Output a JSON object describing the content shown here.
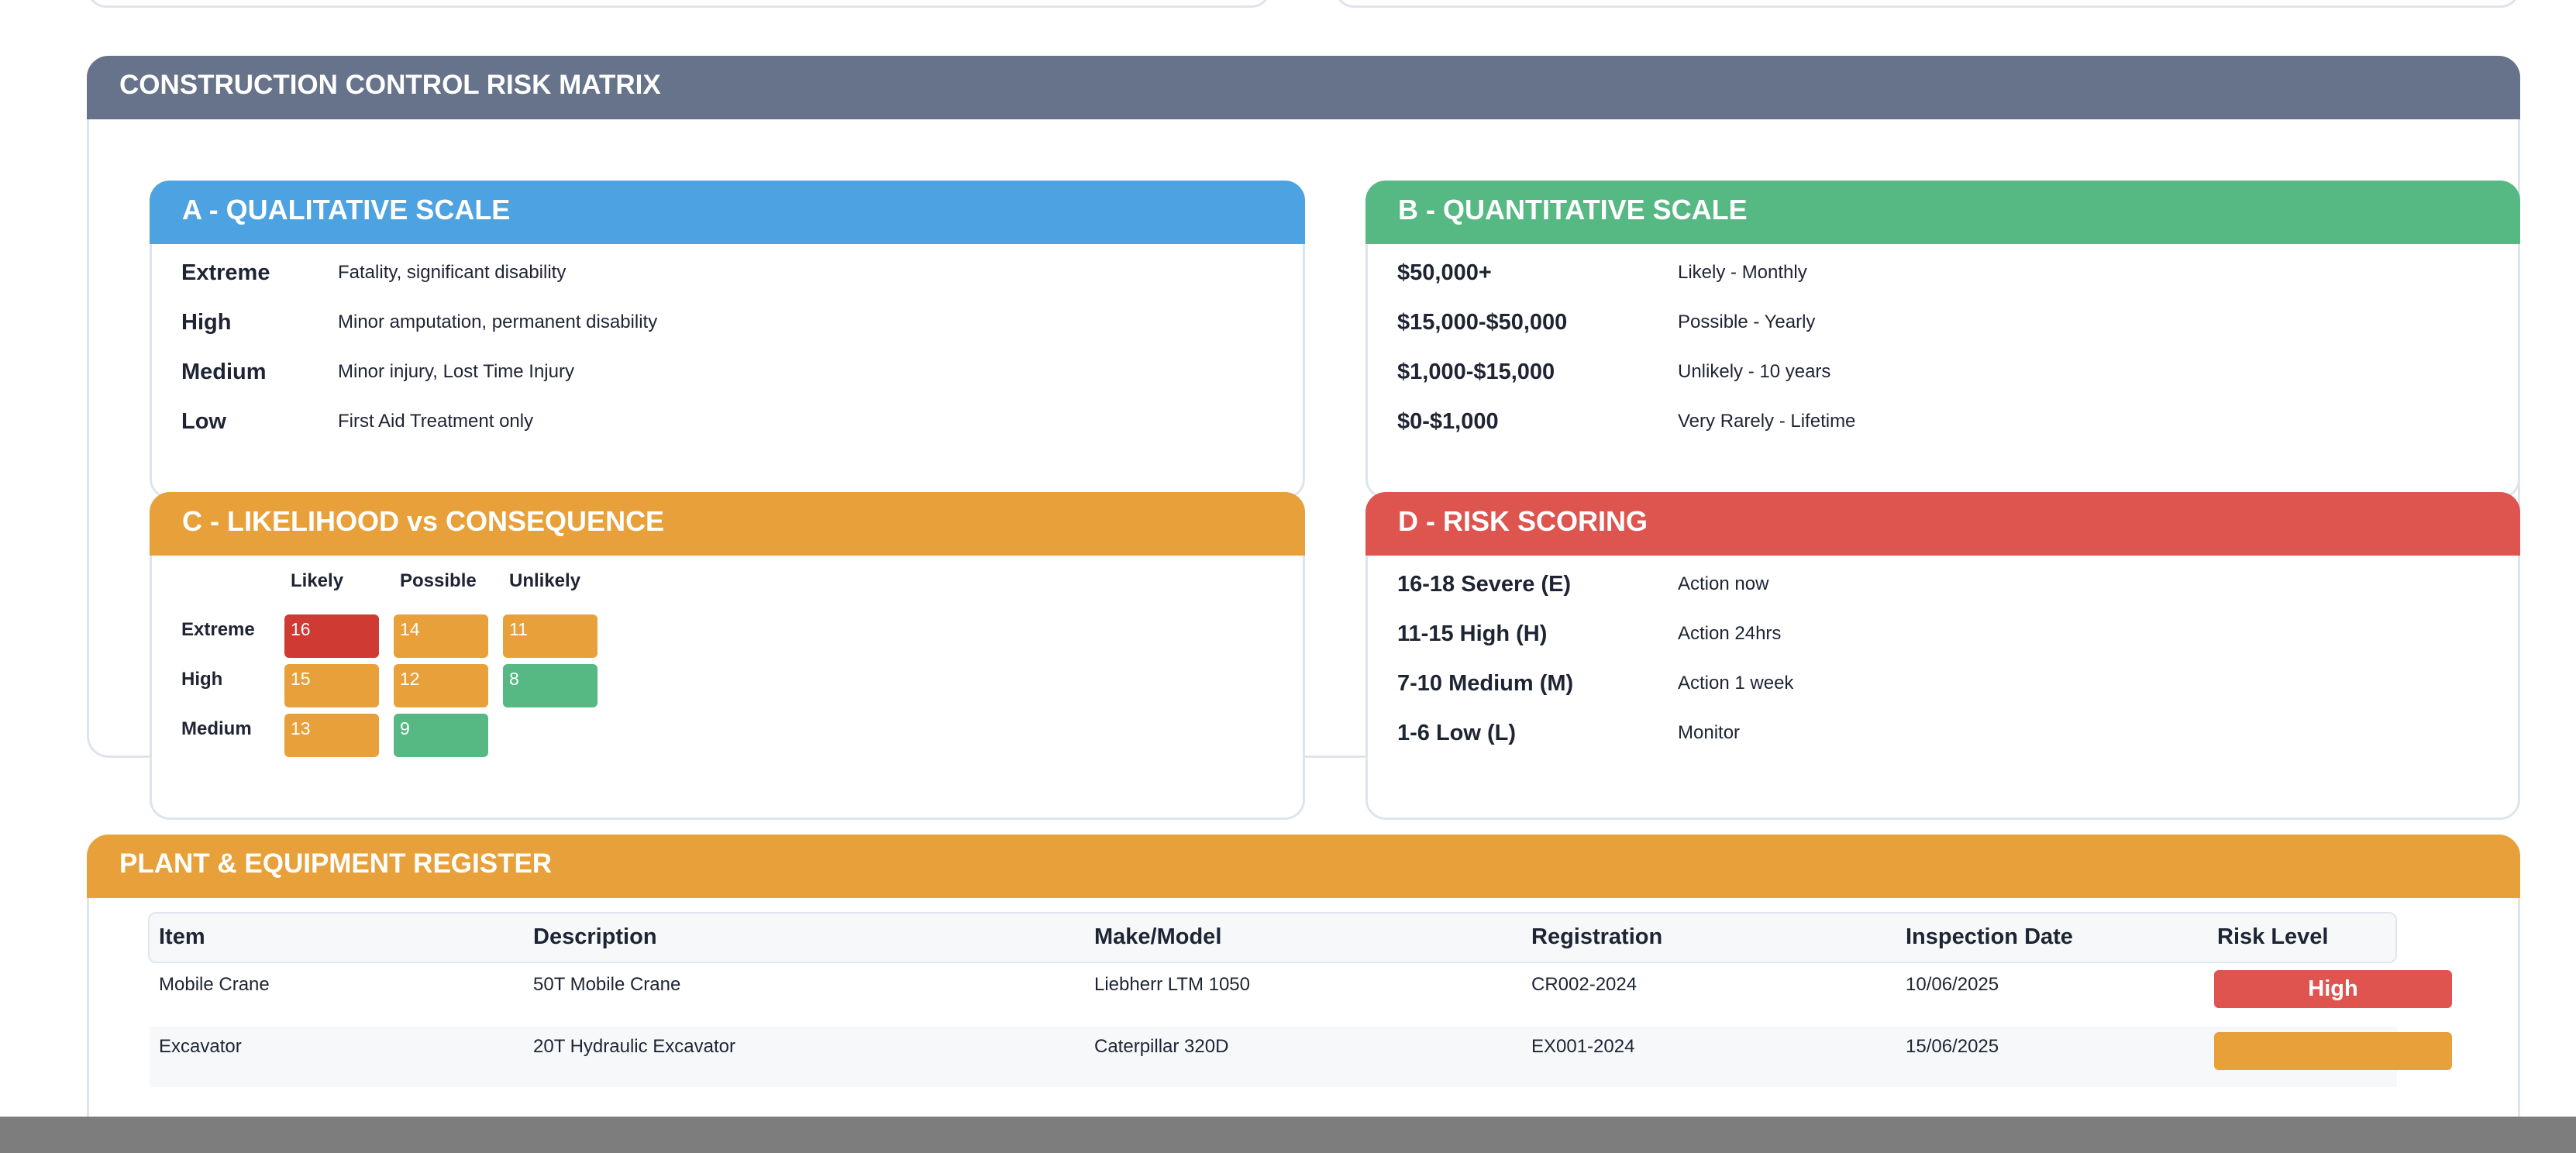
{
  "colors": {
    "matrix_header": "#67738b",
    "qualitative": "#4da2e2",
    "quantitative": "#56b883",
    "likelihood": "#e8a13a",
    "scoring": "#de544f",
    "register_header": "#e8a13a",
    "cell_red": "#cf3a33",
    "cell_orange": "#e8a13a",
    "cell_green": "#56b883",
    "risk_high": "#e05450",
    "risk_medium": "#e8a13a"
  },
  "matrix": {
    "title": "CONSTRUCTION CONTROL RISK MATRIX",
    "qualitative": {
      "title": "A - QUALITATIVE SCALE",
      "rows": [
        {
          "term": "Extreme",
          "desc": "Fatality, significant disability"
        },
        {
          "term": "High",
          "desc": "Minor amputation, permanent disability"
        },
        {
          "term": "Medium",
          "desc": "Minor injury, Lost Time Injury"
        },
        {
          "term": "Low",
          "desc": "First Aid Treatment only"
        }
      ]
    },
    "quantitative": {
      "title": "B - QUANTITATIVE SCALE",
      "rows": [
        {
          "term": "$50,000+",
          "desc": "Likely - Monthly"
        },
        {
          "term": "$15,000-$50,000",
          "desc": "Possible - Yearly"
        },
        {
          "term": "$1,000-$15,000",
          "desc": "Unlikely - 10 years"
        },
        {
          "term": "$0-$1,000",
          "desc": "Very Rarely - Lifetime"
        }
      ]
    },
    "likelihood": {
      "title": "C - LIKELIHOOD vs CONSEQUENCE",
      "columns": [
        "Likely",
        "Possible",
        "Unlikely"
      ],
      "rows": [
        {
          "label": "Extreme",
          "cells": [
            "16",
            "14",
            "11"
          ]
        },
        {
          "label": "High",
          "cells": [
            "15",
            "12",
            "8"
          ]
        },
        {
          "label": "Medium",
          "cells": [
            "13",
            "9"
          ]
        }
      ]
    },
    "scoring": {
      "title": "D - RISK SCORING",
      "rows": [
        {
          "term": "16-18 Severe (E)",
          "desc": "Action now"
        },
        {
          "term": "11-15 High (H)",
          "desc": "Action 24hrs"
        },
        {
          "term": "7-10 Medium (M)",
          "desc": "Action 1 week"
        },
        {
          "term": "1-6 Low (L)",
          "desc": "Monitor"
        }
      ]
    }
  },
  "register": {
    "title": "PLANT & EQUIPMENT REGISTER",
    "columns": [
      "Item",
      "Description",
      "Make/Model",
      "Registration",
      "Inspection Date",
      "Risk Level"
    ],
    "rows": [
      {
        "item": "Mobile Crane",
        "description": "50T Mobile Crane",
        "make": "Liebherr LTM 1050",
        "registration": "CR002-2024",
        "inspection": "10/06/2025",
        "risk": "High"
      },
      {
        "item": "Excavator",
        "description": "20T Hydraulic Excavator",
        "make": "Caterpillar 320D",
        "registration": "EX001-2024",
        "inspection": "15/06/2025",
        "risk": ""
      }
    ]
  }
}
